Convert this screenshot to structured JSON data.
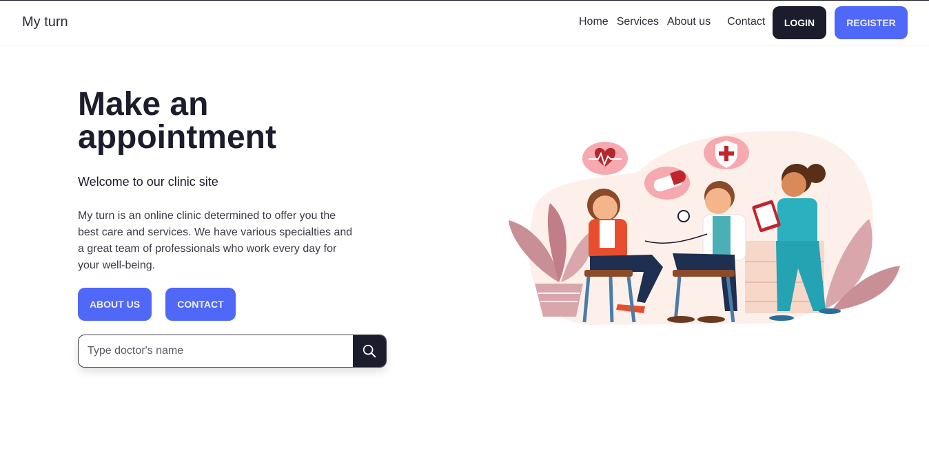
{
  "navbar": {
    "brand": "My turn",
    "links": [
      "Home",
      "Services",
      "About us",
      "Contact"
    ],
    "login_label": "LOGIN",
    "register_label": "REGISTER"
  },
  "hero": {
    "title": "Make an appointment",
    "subtitle": "Welcome to our clinic site",
    "description": "My turn is an online clinic determined to offer you the best care and services. We have various specialties and a great team of professionals who work every day for your well-being.",
    "about_label": "ABOUT US",
    "contact_label": "CONTACT"
  },
  "search": {
    "placeholder": "Type doctor's name",
    "icon": "search-icon"
  },
  "illustration": {
    "icons": [
      "heart-rate-icon",
      "pill-icon",
      "medical-shield-icon"
    ]
  },
  "colors": {
    "accent": "#4f68f8",
    "dark": "#1b1c2c",
    "blob": "#fdf0ea"
  }
}
